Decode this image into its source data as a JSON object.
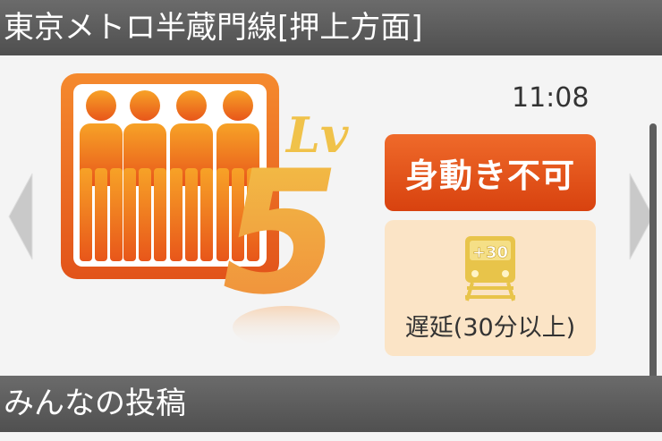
{
  "header": {
    "title": "東京メトロ半蔵門線[押上方面]"
  },
  "status": {
    "time": "11:08",
    "congestion_level_label": "Lv",
    "congestion_level": "5",
    "badge": "身動き不可",
    "delay_icon_text": "+30",
    "delay_label": "遅延(30分以上)"
  },
  "section": {
    "title": "みんなの投稿"
  },
  "icons": {
    "congestion": "crowd-people-icon",
    "delay": "train-delay-icon",
    "nav_left": "chevron-left-icon",
    "nav_right": "chevron-right-icon"
  },
  "colors": {
    "orange": "#e8600f",
    "badge_red": "#d8420f",
    "delay_bg": "#fbe4c6",
    "bar_gray": "#5a5a5a"
  }
}
